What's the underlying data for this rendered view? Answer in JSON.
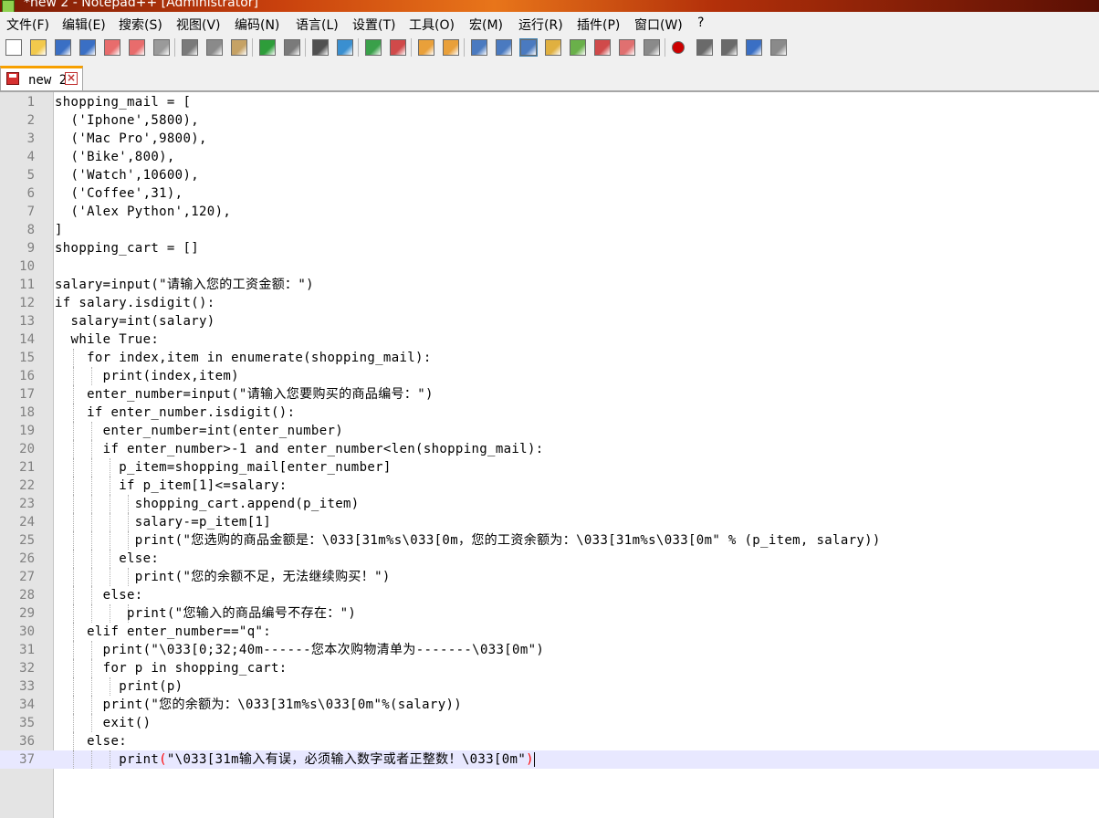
{
  "window": {
    "title": "*new 2 - Notepad++ [Administrator]"
  },
  "menu": [
    "文件(F)",
    "编辑(E)",
    "搜索(S)",
    "视图(V)",
    "编码(N)",
    "语言(L)",
    "设置(T)",
    "工具(O)",
    "宏(M)",
    "运行(R)",
    "插件(P)",
    "窗口(W)",
    "?"
  ],
  "toolbar": {
    "buttons": [
      "new-file-icon",
      "open-file-icon",
      "save-icon",
      "save-all-icon",
      "close-icon",
      "close-all-icon",
      "print-icon",
      "cut-icon",
      "copy-icon",
      "paste-icon",
      "undo-icon",
      "redo-icon",
      "find-icon",
      "replace-icon",
      "zoom-in-icon",
      "zoom-out-icon",
      "sync-vertical-icon",
      "sync-horizontal-icon",
      "word-wrap-icon",
      "show-all-chars-icon",
      "indent-guide-icon",
      "user-language-icon",
      "doc-map-icon",
      "function-list-icon",
      "folder-workspace-icon",
      "monitor-icon",
      "record-macro-icon",
      "stop-macro-icon",
      "play-macro-icon",
      "run-macro-multiple-icon",
      "save-macro-icon"
    ],
    "colors": {
      "record": "#cc0000",
      "accent": "#3c7fb1"
    }
  },
  "tab": {
    "label": "new 2"
  },
  "editor": {
    "current_line": 37,
    "lines": [
      "shopping_mail = [",
      "  ('Iphone',5800),",
      "  ('Mac Pro',9800),",
      "  ('Bike',800),",
      "  ('Watch',10600),",
      "  ('Coffee',31),",
      "  ('Alex Python',120),",
      "]",
      "shopping_cart = []",
      "",
      "salary=input(\"请输入您的工资金额：\")",
      "if salary.isdigit():",
      "  salary=int(salary)",
      "  while True:",
      "    for index,item in enumerate(shopping_mail):",
      "      print(index,item)",
      "    enter_number=input(\"请输入您要购买的商品编号：\")",
      "    if enter_number.isdigit():",
      "      enter_number=int(enter_number)",
      "      if enter_number>-1 and enter_number<len(shopping_mail):",
      "        p_item=shopping_mail[enter_number]",
      "        if p_item[1]<=salary:",
      "          shopping_cart.append(p_item)",
      "          salary-=p_item[1]",
      "          print(\"您选购的商品金额是：\\033[31m%s\\033[0m，您的工资余额为：\\033[31m%s\\033[0m\" % (p_item, salary))",
      "        else:",
      "          print(\"您的余额不足，无法继续购买！\")",
      "      else:",
      "         print(\"您输入的商品编号不存在：\")",
      "    elif enter_number==\"q\":",
      "      print(\"\\033[0;32;40m------您本次购物清单为-------\\033[0m\")",
      "      for p in shopping_cart:",
      "        print(p)",
      "      print(\"您的余额为：\\033[31m%s\\033[0m\"%(salary))",
      "      exit()",
      "    else:",
      "        print(\"\\033[31m输入有误，必须输入数字或者正整数！\\033[0m\")"
    ]
  }
}
